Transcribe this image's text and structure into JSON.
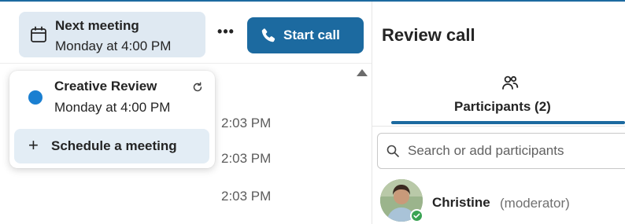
{
  "header": {
    "next_meeting_label": "Next meeting",
    "next_meeting_time": "Monday at 4:00 PM",
    "more_label": "•••",
    "start_call_label": "Start call"
  },
  "messages": {
    "times": [
      "2:03 PM",
      "2:03 PM",
      "2:03 PM"
    ]
  },
  "dropdown": {
    "meeting_title": "Creative Review",
    "meeting_time": "Monday at 4:00 PM",
    "schedule_label": "Schedule a meeting",
    "schedule_icon": "+"
  },
  "right_pane": {
    "title": "Review call",
    "tab_label": "Participants (2)",
    "search_placeholder": "Search or add participants",
    "participant": {
      "name": "Christine",
      "role": "(moderator)"
    }
  },
  "colors": {
    "accent": "#1c6aa0",
    "meeting_dot": "#1a7fd1",
    "presence_online": "#3aa353"
  },
  "icons": [
    "calendar-icon",
    "phone-icon",
    "recurring-icon",
    "plus-icon",
    "participants-icon",
    "search-icon",
    "presence-available-icon"
  ]
}
